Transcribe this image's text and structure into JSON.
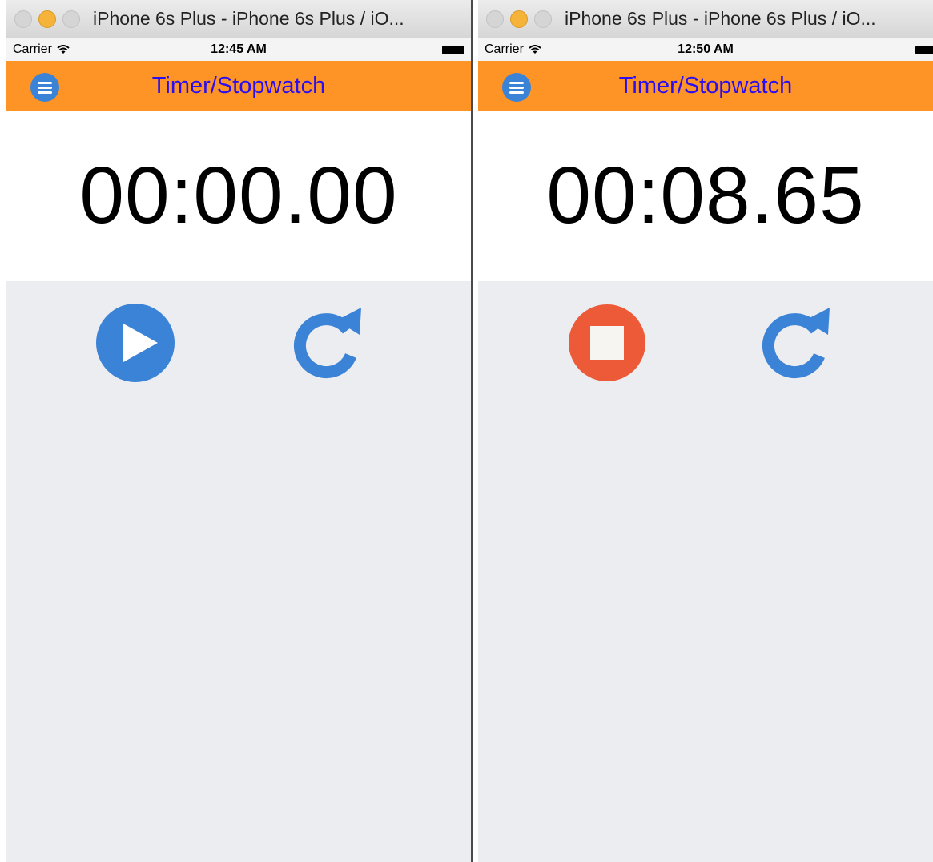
{
  "windows": [
    {
      "title": "iPhone 6s Plus - iPhone 6s Plus / iO...",
      "status": {
        "carrier": "Carrier",
        "time": "12:45 AM"
      },
      "nav": {
        "title": "Timer/Stopwatch"
      },
      "timer": {
        "display": "00:00.00"
      },
      "controls": {
        "primary_icon": "play-icon",
        "reset_icon": "reset-icon"
      }
    },
    {
      "title": "iPhone 6s Plus - iPhone 6s Plus / iO...",
      "status": {
        "carrier": "Carrier",
        "time": "12:50 AM"
      },
      "nav": {
        "title": "Timer/Stopwatch"
      },
      "timer": {
        "display": "00:08.65"
      },
      "controls": {
        "primary_icon": "stop-icon",
        "reset_icon": "reset-icon"
      }
    }
  ],
  "colors": {
    "navbar": "#ff9426",
    "nav_title": "#2a0ef0",
    "accent_blue": "#3b83d6",
    "stop_red": "#ec5a38",
    "controls_bg": "#ecedf1"
  }
}
